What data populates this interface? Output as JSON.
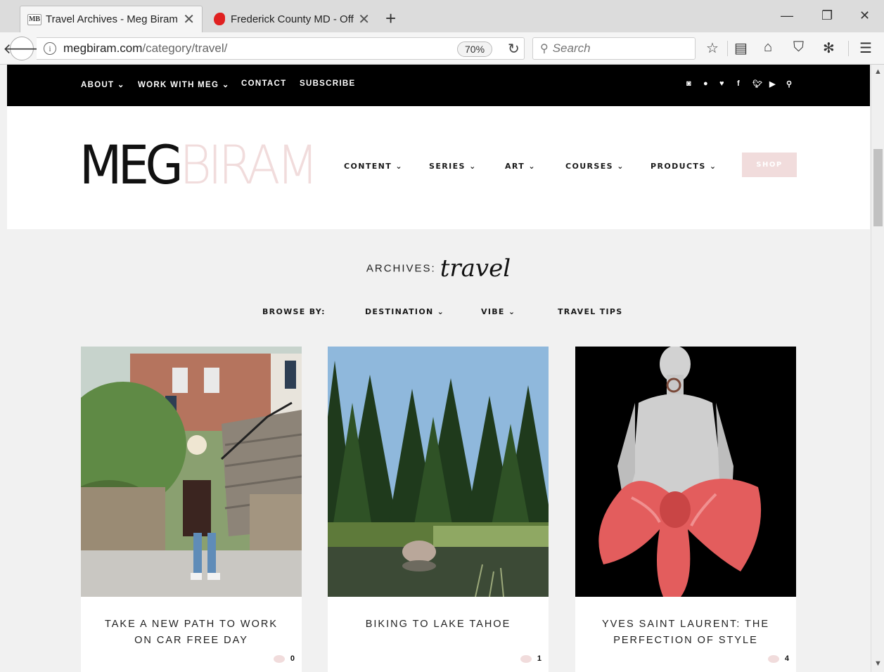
{
  "browser": {
    "tabs": [
      {
        "favicon": "MB",
        "title": "Travel Archives - Meg Biram"
      },
      {
        "favicon": "red-maryland-icon",
        "title": "Frederick County MD - Offici"
      }
    ],
    "url_domain": "megbiram.com",
    "url_path": "/category/travel/",
    "zoom": "70%",
    "search_placeholder": "Search"
  },
  "topnav": {
    "items": [
      "ABOUT ⌄",
      "WORK WITH MEG ⌄",
      "CONTACT",
      "SUBSCRIBE"
    ],
    "social_icons": [
      "instagram-icon",
      "pinterest-icon",
      "heart-icon",
      "facebook-icon",
      "twitter-icon",
      "youtube-icon",
      "search-icon"
    ]
  },
  "header": {
    "logo_meg": "MEG",
    "logo_biram": "BIRAM",
    "nav": [
      "CONTENT ⌄",
      "SERIES ⌄",
      "ART ⌄",
      "COURSES ⌄",
      "PRODUCTS ⌄"
    ],
    "shop_label": "SHOP",
    "colors": {
      "accent_pink": "#f1dcdc"
    }
  },
  "archive": {
    "label": "ARCHIVES:",
    "category": "travel"
  },
  "browse": {
    "label": "BROWSE BY:",
    "items": [
      "DESTINATION ⌄",
      "VIBE ⌄",
      "TRAVEL TIPS"
    ]
  },
  "posts": [
    {
      "title": "TAKE A NEW PATH TO WORK ON CAR FREE DAY",
      "comments": "0",
      "image": "woman-walking-stairs-photo"
    },
    {
      "title": "BIKING TO LAKE TAHOE",
      "comments": "1",
      "image": "forest-lake-photo"
    },
    {
      "title": "YVES SAINT LAURENT: THE PERFECTION OF STYLE",
      "comments": "4",
      "image": "pink-bow-dress-photo"
    }
  ]
}
